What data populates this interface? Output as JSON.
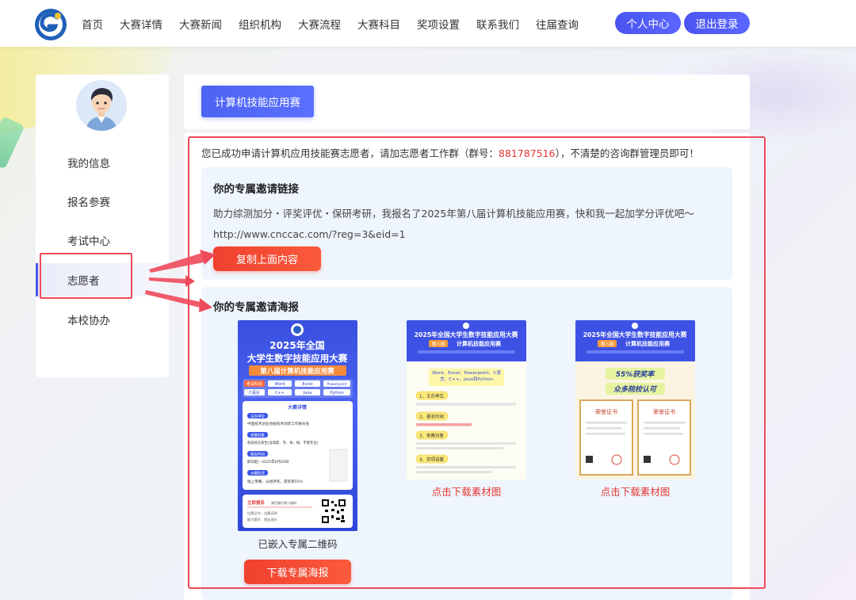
{
  "header": {
    "nav": [
      "首页",
      "大赛详情",
      "大赛新闻",
      "组织机构",
      "大赛流程",
      "大赛科目",
      "奖项设置",
      "联系我们",
      "往届查询"
    ],
    "personal_center": "个人中心",
    "logout": "退出登录"
  },
  "sidebar": {
    "items": [
      {
        "label": "我的信息"
      },
      {
        "label": "报名参赛"
      },
      {
        "label": "考试中心"
      },
      {
        "label": "志愿者"
      },
      {
        "label": "本校协办"
      }
    ],
    "active_index": 3
  },
  "top": {
    "tab_label": "计算机技能应用赛"
  },
  "notice": {
    "prefix": "您已成功申请计算机应用技能赛志愿者，请加志愿者工作群（群号：",
    "group_number": "881787516",
    "suffix": "），不清楚的咨询群管理员即可！"
  },
  "invite_link": {
    "title": "你的专属邀请链接",
    "text": "助力综测加分・评奖评优・保研考研，我报名了2025年第八届计算机技能应用赛，快和我一起加学分评优吧～",
    "url": "http://www.cnccac.com/?reg=3&eid=1",
    "copy_button": "复制上面内容"
  },
  "invite_poster": {
    "title": "你的专属邀请海报",
    "posters": [
      {
        "year_line": "2025年全国",
        "title_line": "大学生数字技能应用大赛",
        "edition_line": "第八届计算机技能应用赛",
        "subjects_label": "考试科目",
        "subjects": [
          "Word",
          "Excel",
          "Powerpoint",
          "C语言",
          "C++",
          "Java",
          "Python"
        ],
        "details_heading": "大赛详情",
        "sections": [
          {
            "label": "主办单位",
            "text": "中国技术创业协会技术创新工作委员会"
          },
          {
            "label": "参赛对象",
            "text": "各高校在校生(含高职、专、本、硕、不限专业)"
          },
          {
            "label": "报名时间",
            "text": "即日起—2025年6月26日"
          },
          {
            "label": "大赛形式",
            "text": "线上参赛，分组评奖，获奖率55%"
          }
        ],
        "signup_label": "立即报名",
        "signup_hint": "请扫描右侧二维码",
        "footer_lines": [
          "比赛证书、比赛证明",
          "能力提升、就业加分"
        ],
        "caption": "已嵌入专属二维码"
      },
      {
        "header": "2025年全国大学生数字技能应用大赛",
        "edition_badge": "第八届",
        "subtitle": "计算机技能应用赛",
        "subject_text": "Word、Excel、Powerpoint、C语言、C++、Java和Python",
        "steps": [
          "1、主办单位",
          "2、报名时间",
          "3、参赛对象",
          "4、奖项设置"
        ],
        "caption": "点击下载素材图"
      },
      {
        "header": "2025年全国大学生数字技能应用大赛",
        "edition_badge": "第八届",
        "subtitle": "计算机技能应用赛",
        "award_line": "55%获奖率",
        "recog_line": "众多院校认可",
        "cert_title": "荣誉证书",
        "caption": "点击下载素材图"
      }
    ],
    "download_button": "下载专属海报"
  },
  "colors": {
    "accent_blue": "#4b55e6",
    "alert_red": "#e53935",
    "panel_bg": "#eef5fc",
    "highlight_red": "#ef4a5a"
  }
}
